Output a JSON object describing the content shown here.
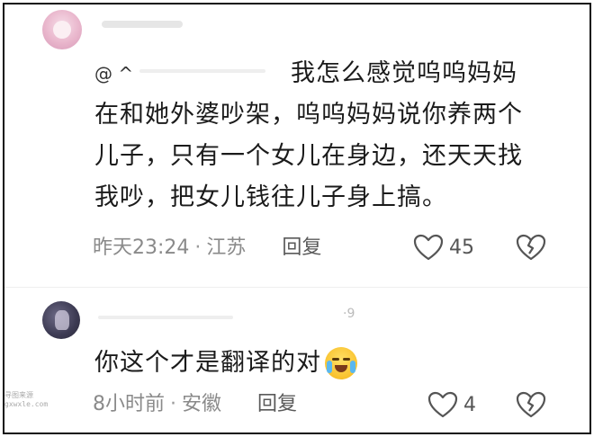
{
  "comments": [
    {
      "mention": "@ ^",
      "text_lines": [
        "我怎么感觉呜呜妈妈",
        "在和她外婆吵架，呜呜妈妈说你养两个",
        "儿子，只有一个女儿在身边，还天天找",
        "我吵，把女儿钱往儿子身上搞。"
      ],
      "time": "昨天23:24",
      "location": "江苏",
      "reply_label": "回复",
      "likes": "45"
    },
    {
      "partial_name": "·9",
      "text": "你这个才是翻译的对",
      "emoji": "laughing-crying-emoji",
      "time": "8小时前",
      "location": "安徽",
      "reply_label": "回复",
      "likes": "4"
    }
  ],
  "meta_separator": "·",
  "watermark_lines": [
    "寻图来源",
    "gxwxle.com"
  ],
  "colors": {
    "text": "#1b1b1b",
    "meta": "#8a8a8a",
    "icon": "#555555",
    "frame": "#111111"
  }
}
